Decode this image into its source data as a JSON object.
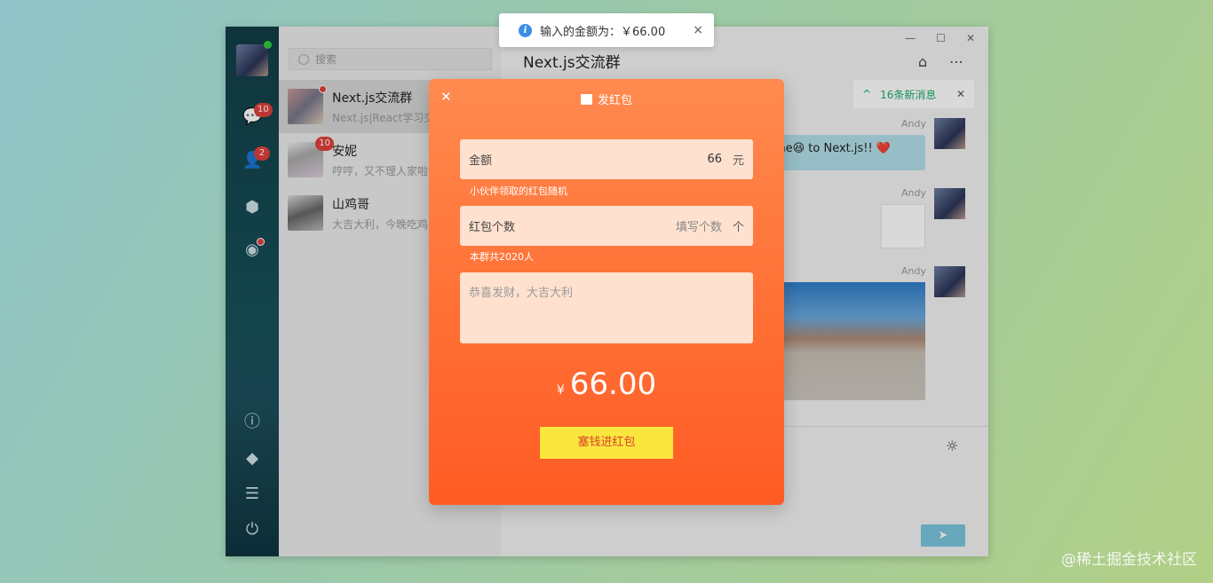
{
  "toast": {
    "message": "输入的金额为：￥66.00",
    "close": "×"
  },
  "window_controls": {
    "minimize": "—",
    "maximize": "☐",
    "close": "✕"
  },
  "sidebar": {
    "badges": {
      "chat": "10",
      "contacts": "2"
    },
    "icons": [
      "chat-icon",
      "contacts-icon",
      "cube-icon",
      "discover-icon",
      "info-icon",
      "paint-bucket-icon",
      "settings-icon",
      "power-icon"
    ]
  },
  "search": {
    "placeholder": "搜索"
  },
  "chats": [
    {
      "name": "Next.js交流群",
      "preview": "Next.js|React学习交",
      "badge": ""
    },
    {
      "name": "安妮",
      "preview": "哼哼，又不理人家啦",
      "badge": "10"
    },
    {
      "name": "山鸡哥",
      "preview": "大吉大利，今晚吃鸡",
      "badge": ""
    }
  ],
  "main": {
    "title": "Next.js交流群",
    "new_messages": "16条新消息",
    "messages": [
      {
        "sender": "Andy",
        "text": "ome😆 to Next.js!! ❤️"
      },
      {
        "sender": "Andy"
      },
      {
        "sender": "Andy"
      }
    ],
    "send_icon": "send-icon",
    "bulb_icon": "bulb-icon"
  },
  "redpacket": {
    "title": "发红包",
    "amount_label": "金额",
    "amount_value": "66",
    "amount_unit": "元",
    "amount_hint": "小伙伴领取的红包随机",
    "count_label": "红包个数",
    "count_placeholder": "填写个数",
    "count_unit": "个",
    "count_hint": "本群共2020人",
    "message_placeholder": "恭喜发财，大吉大利",
    "currency": "¥",
    "total": "66.00",
    "submit": "塞钱进红包"
  },
  "watermark": "@稀土掘金技术社区",
  "colors": {
    "sidebar": "#153f47",
    "accent_green": "#1aad6c",
    "packet": "#ff6f33",
    "submit": "#fbe63e"
  }
}
